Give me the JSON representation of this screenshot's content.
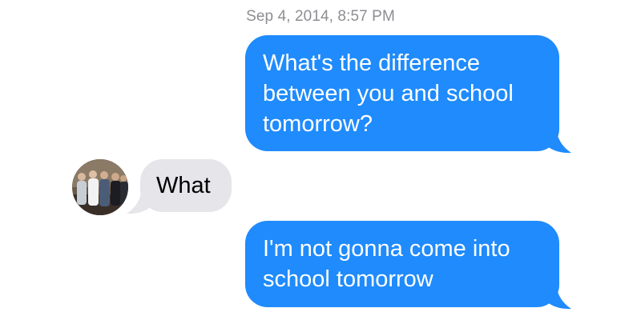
{
  "conversation": {
    "timestamp": "Sep 4, 2014, 8:57 PM",
    "messages": [
      {
        "direction": "outgoing",
        "text": "What's the difference between you and school tomorrow?"
      },
      {
        "direction": "incoming",
        "text": "What",
        "sender_avatar": "group-photo-avatar"
      },
      {
        "direction": "outgoing",
        "text": "I'm not gonna come into school tomorrow"
      }
    ]
  },
  "colors": {
    "outgoing_bubble": "#1f8bfd",
    "incoming_bubble": "#e5e5ea",
    "timestamp_text": "#8e8e93"
  }
}
